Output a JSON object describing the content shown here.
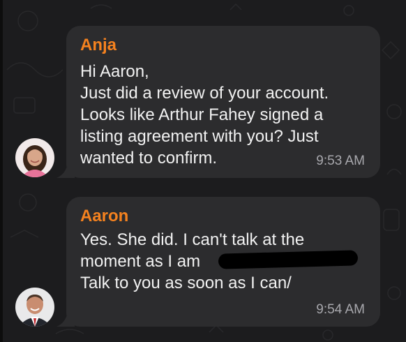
{
  "messages": [
    {
      "sender": "Anja",
      "text": "Hi Aaron,\nJust did a review of your account.\nLooks like Arthur Fahey signed a\nlisting agreement with you? Just\nwanted to confirm.",
      "time": "9:53 AM",
      "avatar_icon": "female-avatar-icon"
    },
    {
      "sender": "Aaron",
      "text": "Yes. She did. I can't talk at the\nmoment as I am\nTalk to you as soon as I can/",
      "time": "9:54 AM",
      "avatar_icon": "male-avatar-icon",
      "has_redaction": true
    }
  ],
  "colors": {
    "background": "#1c1c1e",
    "bubble": "#2c2c2e",
    "sender_name": "#f5821f",
    "timestamp": "#a8a8ad",
    "text": "#f2f2f2"
  }
}
